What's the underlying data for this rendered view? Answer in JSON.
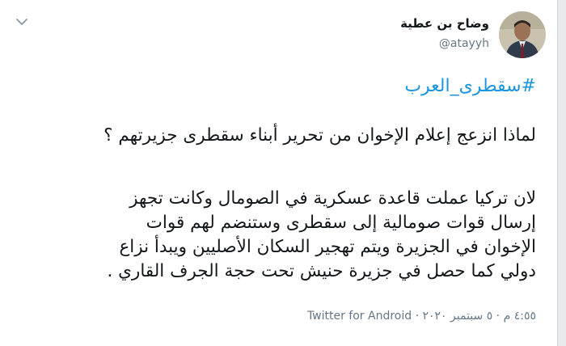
{
  "user": {
    "display_name": "وضاح بن عطية",
    "handle": "@atayyh"
  },
  "tweet": {
    "hashtag": "#سقطرى_العرب",
    "lines": [
      "لماذا انزعج إعلام الإخوان من تحرير أبناء سقطرى جزيرتهم ؟",
      "لان تركيا عملت قاعدة عسكرية في الصومال وكانت تجهز",
      "إرسال قوات صومالية إلى سقطرى وستنضم لهم قوات",
      "الإخوان في الجزيرة ويتم تهجير السكان الأصليين ويبدأ نزاع",
      "دولي كما حصل في جزيرة حنيش تحت حجة الجرف القاري ."
    ]
  },
  "meta": {
    "time": "٤:٥٥ م",
    "date": "٥ سبتمبر ٢٠٢٠",
    "separator": " · ",
    "source": "Twitter for Android"
  },
  "colors": {
    "link": "#1b95e0",
    "secondary": "#657786"
  },
  "icons": {
    "more": "chevron-down-icon",
    "avatar": "avatar"
  }
}
